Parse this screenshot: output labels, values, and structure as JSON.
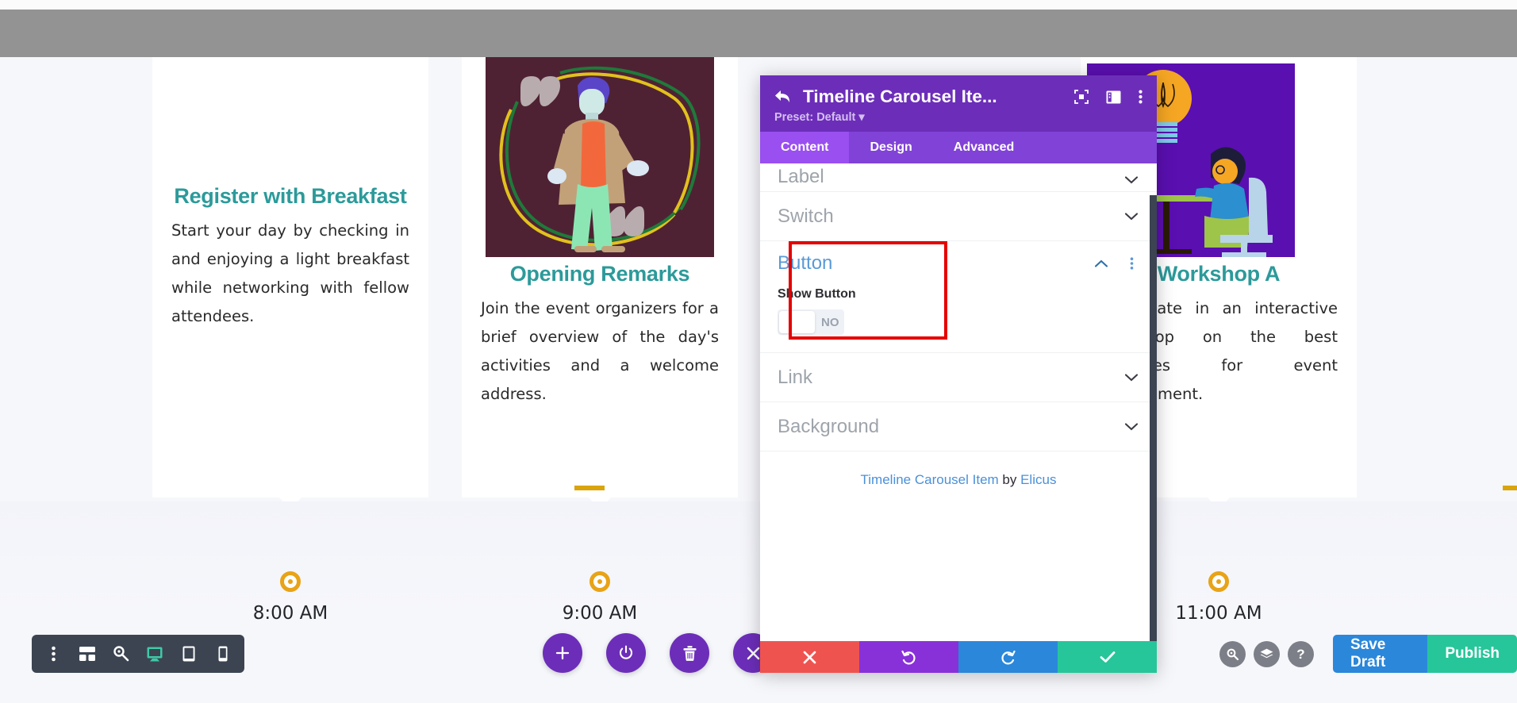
{
  "page": {
    "timeline_cards": [
      {
        "title": "Register with Breakfast",
        "body": "Start your day by checking in and enjoying a light breakfast while networking with fellow attendees.",
        "time": "8:00 AM",
        "has_illustration": false,
        "illustration": ""
      },
      {
        "title": "Opening Remarks",
        "body": "Join the event organizers for a brief overview of the day's activities and a welcome address.",
        "time": "9:00 AM",
        "has_illustration": true,
        "illustration": "speaker-with-quotes-illustration"
      },
      {
        "title": "Workshop A",
        "body": "Participate in an interactive workshop on the best practices for event engagement.",
        "time": "11:00 AM",
        "has_illustration": true,
        "illustration": "two-people-table-lightbulb-illustration"
      }
    ],
    "colors": {
      "title_teal": "#2c9a9a",
      "timeline_orange": "#e8a317",
      "divider_orange": "#d9a40c",
      "accent_purple": "#6c2eb9",
      "highlight_red": "#e60000"
    }
  },
  "left_toolbar": {
    "items": [
      {
        "name": "more-options",
        "icon": "vertical-dots-icon",
        "active": false
      },
      {
        "name": "wireframe-view",
        "icon": "wireframe-icon",
        "active": false
      },
      {
        "name": "zoom-view",
        "icon": "magnifier-icon",
        "active": false
      },
      {
        "name": "desktop-view",
        "icon": "desktop-icon",
        "active": true
      },
      {
        "name": "tablet-view",
        "icon": "tablet-icon",
        "active": false
      },
      {
        "name": "phone-view",
        "icon": "phone-icon",
        "active": false
      }
    ]
  },
  "fab_buttons": [
    {
      "name": "add-module",
      "icon": "plus-icon"
    },
    {
      "name": "toggle-builder",
      "icon": "power-icon"
    },
    {
      "name": "delete-module",
      "icon": "trash-icon"
    },
    {
      "name": "close-builder",
      "icon": "close-x-icon"
    }
  ],
  "bottom_right": {
    "round_buttons": [
      {
        "name": "search",
        "icon": "magnifier-icon",
        "glyph": "⌕"
      },
      {
        "name": "layers",
        "icon": "layers-icon",
        "glyph": "≣"
      },
      {
        "name": "help",
        "icon": "question-mark-icon",
        "glyph": "?"
      }
    ],
    "save_draft_label": "Save Draft",
    "publish_label": "Publish"
  },
  "modal": {
    "title": "Timeline Carousel Ite...",
    "preset_label": "Preset: Default",
    "back_icon": "back-arrow-icon",
    "header_icons": [
      {
        "name": "focus-module",
        "icon": "focus-brackets-icon"
      },
      {
        "name": "panel-layout",
        "icon": "panel-layout-icon"
      },
      {
        "name": "module-options",
        "icon": "vertical-dots-icon"
      }
    ],
    "tabs": [
      {
        "label": "Content",
        "active": true
      },
      {
        "label": "Design",
        "active": false
      },
      {
        "label": "Advanced",
        "active": false
      }
    ],
    "sections": [
      {
        "label": "Label",
        "state": "collapsed",
        "chevron": "chevron-down-icon",
        "partial": true
      },
      {
        "label": "Switch",
        "state": "collapsed",
        "chevron": "chevron-down-icon",
        "partial": false
      }
    ],
    "button_section": {
      "title": "Button",
      "chevron": "chevron-up-icon",
      "options_icon": "vertical-dots-icon",
      "field_label": "Show Button",
      "toggle_value": "NO",
      "toggle_on": false,
      "highlighted": true
    },
    "sections_after": [
      {
        "label": "Link",
        "state": "collapsed",
        "chevron": "chevron-down-icon"
      },
      {
        "label": "Background",
        "state": "collapsed",
        "chevron": "chevron-down-icon"
      }
    ],
    "credit": {
      "module_name": "Timeline Carousel Item",
      "by_text": " by ",
      "author": "Elicus"
    },
    "footer_buttons": [
      {
        "name": "discard-changes",
        "icon": "close-x-icon",
        "color": "#ef5350"
      },
      {
        "name": "undo",
        "icon": "undo-arrow-icon",
        "color": "#8831d8"
      },
      {
        "name": "redo",
        "icon": "redo-arrow-icon",
        "color": "#2b87da"
      },
      {
        "name": "save-changes",
        "icon": "checkmark-icon",
        "color": "#27c59a"
      }
    ]
  }
}
